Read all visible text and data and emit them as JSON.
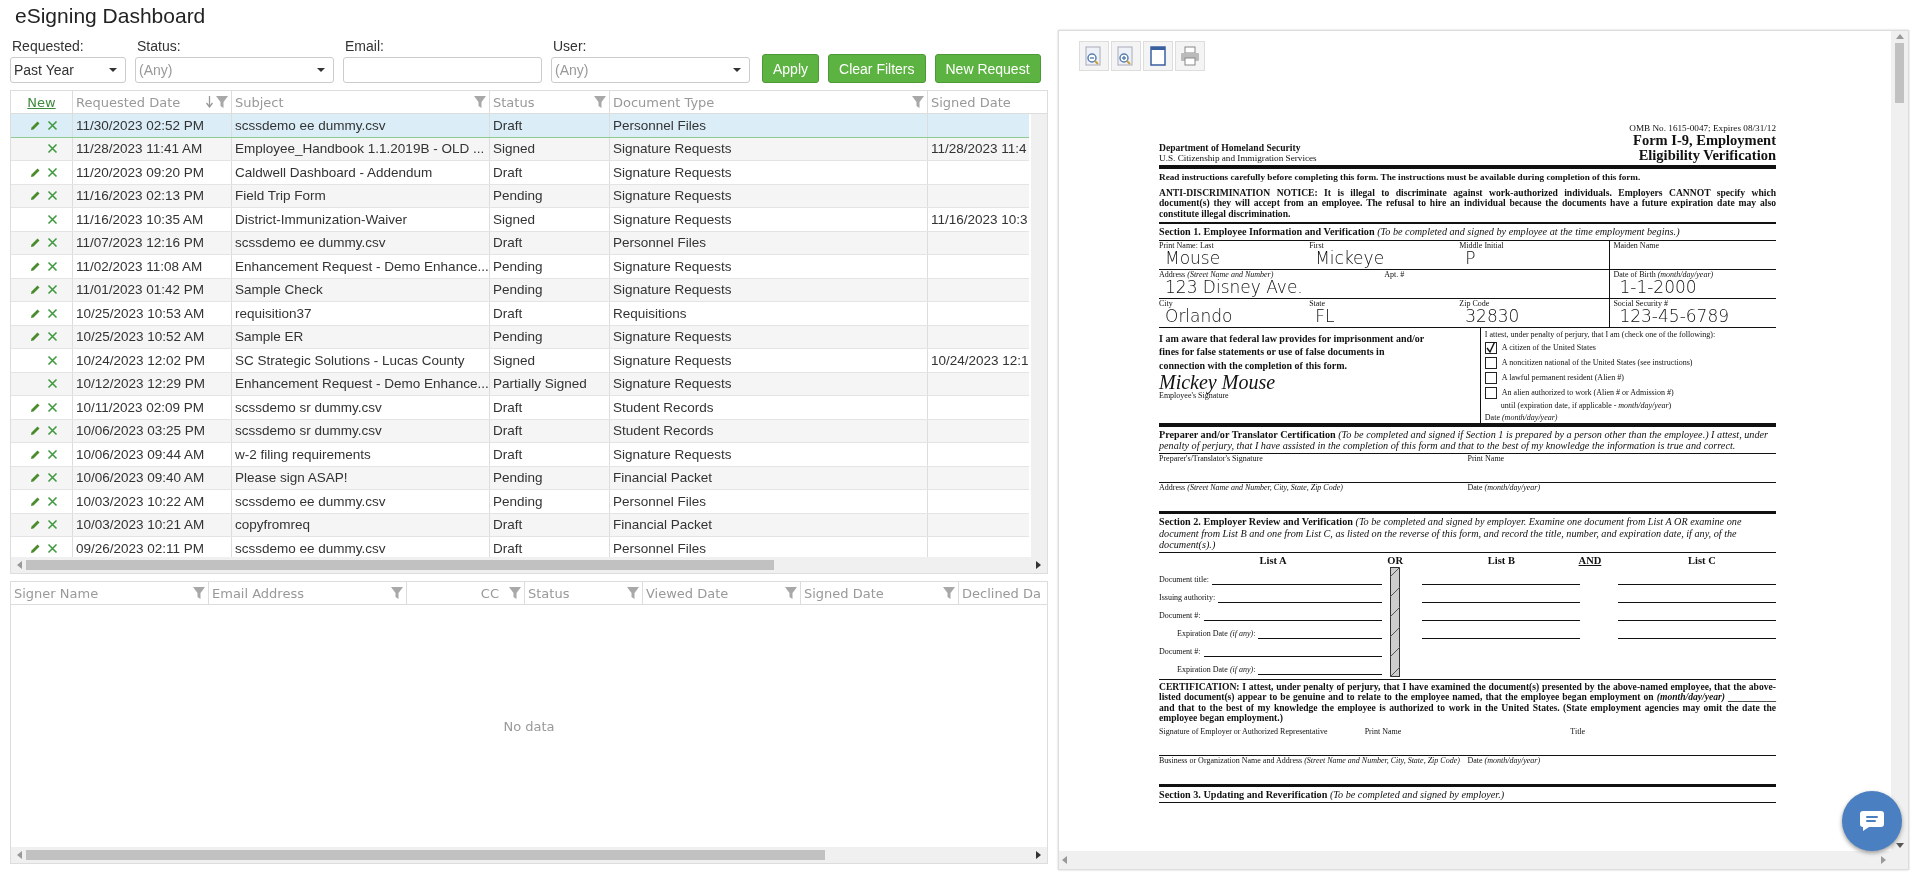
{
  "title": "eSigning Dashboard",
  "filters": [
    {
      "kind": "select",
      "label": "Requested:",
      "value": "Past Year"
    },
    {
      "kind": "select",
      "label": "Status:",
      "placeholder": "(Any)"
    },
    {
      "kind": "text",
      "label": "Email:"
    },
    {
      "kind": "select",
      "label": "User:",
      "placeholder": "(Any)"
    }
  ],
  "buttons": [
    "Apply",
    "Clear Filters",
    "New Request"
  ],
  "requests_table": {
    "new_link": "New",
    "columns": [
      {
        "label": "Requested Date",
        "sorted": true,
        "filter": true
      },
      {
        "label": "Subject",
        "sorted": false,
        "filter": true
      },
      {
        "label": "Status",
        "sorted": false,
        "filter": true
      },
      {
        "label": "Document Type",
        "sorted": false,
        "filter": true
      },
      {
        "label": "Signed Date",
        "sorted": false,
        "filter": false
      }
    ],
    "rows": [
      {
        "selected": true,
        "editable": true,
        "cells": [
          "11/30/2023 02:52 PM",
          "scssdemo ee dummy.csv",
          "Draft",
          "Personnel Files",
          ""
        ]
      },
      {
        "selected": false,
        "editable": false,
        "cells": [
          "11/28/2023 11:41 AM",
          "Employee_Handbook 1.1.2019B - OLD ...",
          "Signed",
          "Signature Requests",
          "11/28/2023 11:4"
        ]
      },
      {
        "selected": false,
        "editable": true,
        "cells": [
          "11/20/2023 09:20 PM",
          "Caldwell Dashboard - Addendum",
          "Draft",
          "Signature Requests",
          ""
        ]
      },
      {
        "selected": false,
        "editable": true,
        "cells": [
          "11/16/2023 02:13 PM",
          "Field Trip Form",
          "Pending",
          "Signature Requests",
          ""
        ]
      },
      {
        "selected": false,
        "editable": false,
        "cells": [
          "11/16/2023 10:35 AM",
          "District-Immunization-Waiver",
          "Signed",
          "Signature Requests",
          "11/16/2023 10:3"
        ]
      },
      {
        "selected": false,
        "editable": true,
        "cells": [
          "11/07/2023 12:16 PM",
          "scssdemo ee dummy.csv",
          "Draft",
          "Personnel Files",
          ""
        ]
      },
      {
        "selected": false,
        "editable": true,
        "cells": [
          "11/02/2023 11:08 AM",
          "Enhancement Request - Demo Enhance...",
          "Pending",
          "Signature Requests",
          ""
        ]
      },
      {
        "selected": false,
        "editable": true,
        "cells": [
          "11/01/2023 01:42 PM",
          "Sample Check",
          "Pending",
          "Signature Requests",
          ""
        ]
      },
      {
        "selected": false,
        "editable": true,
        "cells": [
          "10/25/2023 10:53 AM",
          "requisition37",
          "Draft",
          "Requisitions",
          ""
        ]
      },
      {
        "selected": false,
        "editable": true,
        "cells": [
          "10/25/2023 10:52 AM",
          "Sample ER",
          "Pending",
          "Signature Requests",
          ""
        ]
      },
      {
        "selected": false,
        "editable": false,
        "cells": [
          "10/24/2023 12:02 PM",
          "SC Strategic Solutions - Lucas County",
          "Signed",
          "Signature Requests",
          "10/24/2023 12:1"
        ]
      },
      {
        "selected": false,
        "editable": false,
        "cells": [
          "10/12/2023 12:29 PM",
          "Enhancement Request - Demo Enhance...",
          "Partially Signed",
          "Signature Requests",
          ""
        ]
      },
      {
        "selected": false,
        "editable": true,
        "cells": [
          "10/11/2023 02:09 PM",
          "scssdemo sr dummy.csv",
          "Draft",
          "Student Records",
          ""
        ]
      },
      {
        "selected": false,
        "editable": true,
        "cells": [
          "10/06/2023 03:25 PM",
          "scssdemo sr dummy.csv",
          "Draft",
          "Student Records",
          ""
        ]
      },
      {
        "selected": false,
        "editable": true,
        "cells": [
          "10/06/2023 09:44 AM",
          "w-2 filing requirements",
          "Draft",
          "Signature Requests",
          ""
        ]
      },
      {
        "selected": false,
        "editable": true,
        "cells": [
          "10/06/2023 09:40 AM",
          "Please sign ASAP!",
          "Pending",
          "Financial Packet",
          ""
        ]
      },
      {
        "selected": false,
        "editable": true,
        "cells": [
          "10/03/2023 10:22 AM",
          "scssdemo ee dummy.csv",
          "Pending",
          "Personnel Files",
          ""
        ]
      },
      {
        "selected": false,
        "editable": true,
        "cells": [
          "10/03/2023 10:21 AM",
          "copyfromreq",
          "Draft",
          "Financial Packet",
          ""
        ]
      },
      {
        "selected": false,
        "editable": true,
        "cells": [
          "09/26/2023 02:11 PM",
          "scssdemo ee dummy.csv",
          "Draft",
          "Personnel Files",
          ""
        ]
      }
    ]
  },
  "signers_table": {
    "columns": [
      "Signer Name",
      "Email Address",
      "CC",
      "Status",
      "Viewed Date",
      "Signed Date",
      "Declined Da"
    ],
    "empty_text": "No data"
  },
  "document": {
    "omb": "OMB No. 1615-0047; Expires 08/31/12",
    "agency": [
      "Department of Homeland Security",
      "U.S. Citizenship and Immigration Services"
    ],
    "title": [
      "Form I-9, Employment",
      "Eligibility Verification"
    ],
    "blocks": [
      {
        "kind": "text",
        "text": "Read instructions carefully before completing this form.  The instructions must be available during completion of this form."
      },
      {
        "kind": "notice",
        "text": "ANTI-DISCRIMINATION NOTICE:  It is illegal to discriminate against work-authorized individuals. Employers CANNOT specify which document(s) they will accept from an employee.  The refusal to hire an individual because the documents have a future expiration date may also constitute illegal discrimination."
      },
      {
        "kind": "section",
        "text": "**Section 1. Employee Information and Verification** *(To be completed and signed by employee at the time employment begins.)*"
      },
      {
        "kind": "fields",
        "cells": [
          {
            "label": "Print Name:   Last",
            "value": "Mouse"
          },
          {
            "label": "First",
            "value": "Mickeye"
          },
          {
            "label": "Middle Initial",
            "value": "P"
          },
          {
            "label": "Maiden Name"
          }
        ]
      },
      {
        "kind": "fields",
        "cells": [
          {
            "label": "Address *(Street Name and Number)*",
            "value": "123 Disney Ave."
          },
          {
            "label": "Apt. #"
          },
          {
            "label": "Date of Birth *(month/day/year)*",
            "value": "1-1-2000"
          }
        ]
      },
      {
        "kind": "fields",
        "cells": [
          {
            "label": "City",
            "value": "Orlando"
          },
          {
            "label": "State",
            "value": "FL"
          },
          {
            "label": "Zip Code",
            "value": "32830"
          },
          {
            "label": "Social Security #",
            "value": "123-45-6789"
          }
        ]
      },
      {
        "kind": "attest",
        "statement": "I am aware that federal law provides for imprisonment and/or fines for false statements or use of false documents in connection with the completion of this form.",
        "signature": "Mickey Mouse",
        "signature_label": "Employee's Signature",
        "heading": "I attest, under penalty of perjury, that I am (check one of the following):",
        "options": [
          {
            "label": "A citizen of the United States",
            "checked": true
          },
          {
            "label": "A noncitizen national of the United States (see instructions)",
            "checked": false
          },
          {
            "label": "A lawful permanent resident (Alien #)",
            "checked": false
          },
          {
            "label": "An alien authorized to work (Alien # or Admission #)",
            "checked": false
          }
        ],
        "until": "until (expiration date, if applicable - *month/day/year*)",
        "date_label": "Date *(month/day/year)*"
      },
      {
        "kind": "section",
        "text": "**Preparer and/or Translator Certification** *(To be completed and signed if Section 1 is prepared by a person other than the employee.) I attest, under penalty of perjury, that I have assisted in the completion of this form and that to the best of my knowledge the information is true and correct.*"
      },
      {
        "kind": "fields",
        "cells": [
          {
            "label": "Preparer's/Translator's Signature"
          },
          {
            "label": "Print Name"
          }
        ]
      },
      {
        "kind": "fields",
        "cells": [
          {
            "label": "Address *(Street Name and Number, City, State, Zip Code)*"
          },
          {
            "label": "Date *(month/day/year)*"
          }
        ]
      },
      {
        "kind": "section",
        "text": "**Section 2. Employer Review and Verification** *(To be completed and signed by employer. Examine one document from List A OR examine one document from List B and one from List C, as listed on the reverse of this form, and record the title, number, and expiration date, if any, of the document(s).)*"
      },
      {
        "kind": "lists",
        "headers": [
          "List A",
          "OR",
          "List B",
          "AND",
          "List C"
        ],
        "labels": [
          "Document title:",
          "Issuing authority:",
          "Document #:",
          "Expiration Date *(if any)*:",
          "Document #:",
          "Expiration Date *(if any)*:"
        ]
      },
      {
        "kind": "notice",
        "text": "CERTIFICATION: I attest, under penalty of perjury, that I have examined the document(s) presented by the above-named employee, that the above-listed document(s) appear to be genuine and to relate to the employee named, that the employee began employment on *(month/day/year)*  __________  and that to the best of my knowledge the employee is authorized to work in the United States.   (State employment agencies may omit the date the employee began employment.)"
      },
      {
        "kind": "fields",
        "cells": [
          {
            "label": "Signature of Employer or Authorized Representative"
          },
          {
            "label": "Print Name"
          },
          {
            "label": "Title"
          }
        ]
      },
      {
        "kind": "fields",
        "cells": [
          {
            "label": "Business or Organization Name and Address *(Street Name and Number, City, State, Zip Code)*"
          },
          {
            "label": "Date *(month/day/year)*"
          }
        ]
      },
      {
        "kind": "section",
        "text": "**Section 3. Updating and Reverification** *(To be completed and signed by employer.)*"
      }
    ]
  }
}
